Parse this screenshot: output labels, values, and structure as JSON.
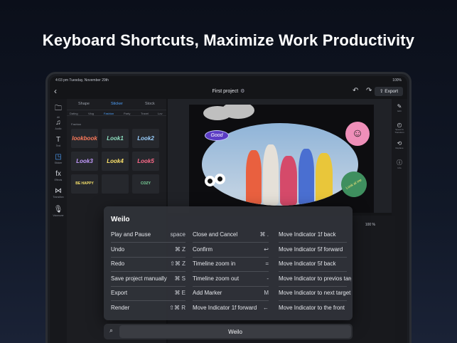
{
  "headline": "Keyboard Shortcuts, Maximize Work Productivity",
  "status": {
    "time": "4:03 pm   Tuesday, November 29th",
    "battery": "100%"
  },
  "toolbar": {
    "project_title": "First project",
    "export_label": "Export"
  },
  "left_tools": [
    {
      "icon": "folder-icon",
      "glyph": "🗀",
      "label": "All"
    },
    {
      "icon": "music-icon",
      "glyph": "♫",
      "label": "Audio"
    },
    {
      "icon": "text-icon",
      "glyph": "T",
      "label": "Text"
    },
    {
      "icon": "sticker-icon",
      "glyph": "◳",
      "label": "Sticker"
    },
    {
      "icon": "effects-icon",
      "glyph": "fx",
      "label": "Effects"
    },
    {
      "icon": "transition-icon",
      "glyph": "⋈",
      "label": "Transition"
    },
    {
      "icon": "voiceover-icon",
      "glyph": "🎙",
      "label": "Voiceover"
    }
  ],
  "panel": {
    "tabs": [
      "Shape",
      "Sticker",
      "Stock"
    ],
    "subtabs": [
      "Dating",
      "Vlog",
      "Fashion",
      "Party",
      "Travel",
      "Lov"
    ],
    "category": "Fashion",
    "stickers": [
      "lookbook",
      "Look1",
      "Look2",
      "Look3",
      "Look4",
      "Look5",
      "BE HAPPY",
      "",
      "COZY"
    ]
  },
  "canvas": {
    "tag_good": "Good",
    "tag_look": "Look at me",
    "smiley": "☺"
  },
  "right_tools": [
    {
      "icon": "edit-icon",
      "glyph": "✎",
      "label": "Edit"
    },
    {
      "icon": "speed-icon",
      "glyph": "◴",
      "label": "Speed & Transform"
    },
    {
      "icon": "replace-icon",
      "glyph": "⟲",
      "label": "Replace"
    },
    {
      "icon": "info-icon",
      "glyph": "ⓘ",
      "label": "Info"
    }
  ],
  "timeline": {
    "zoom": "100 %"
  },
  "shortcuts": {
    "title": "Weilo",
    "columns": [
      [
        {
          "action": "Play and Pause",
          "key": "space"
        },
        {
          "action": "Undo",
          "key": "⌘ Z"
        },
        {
          "action": "Redo",
          "key": "⇧⌘ Z"
        },
        {
          "action": "Save project manually",
          "key": "⌘ S"
        },
        {
          "action": "Export",
          "key": "⌘ E"
        },
        {
          "action": "Render",
          "key": "⇧⌘ R"
        }
      ],
      [
        {
          "action": "Close and Cancel",
          "key": "⌘ ."
        },
        {
          "action": "Confirm",
          "key": "↩"
        },
        {
          "action": "Timeline zoom in",
          "key": "="
        },
        {
          "action": "Timeline zoom out",
          "key": "-"
        },
        {
          "action": "Add Marker",
          "key": "M"
        },
        {
          "action": "Move Indicator 1f forward",
          "key": "←"
        }
      ],
      [
        {
          "action": "Move Indicator 1f back",
          "key": ""
        },
        {
          "action": "Move Indicator 5f forward",
          "key": ""
        },
        {
          "action": "Move Indicator 5f back",
          "key": ""
        },
        {
          "action": "Move Indicator to previos targ",
          "key": ""
        },
        {
          "action": "Move Indicator to next target",
          "key": ""
        },
        {
          "action": "Move Indicator to the front",
          "key": ""
        }
      ]
    ]
  },
  "search": {
    "value": "Weilo"
  }
}
